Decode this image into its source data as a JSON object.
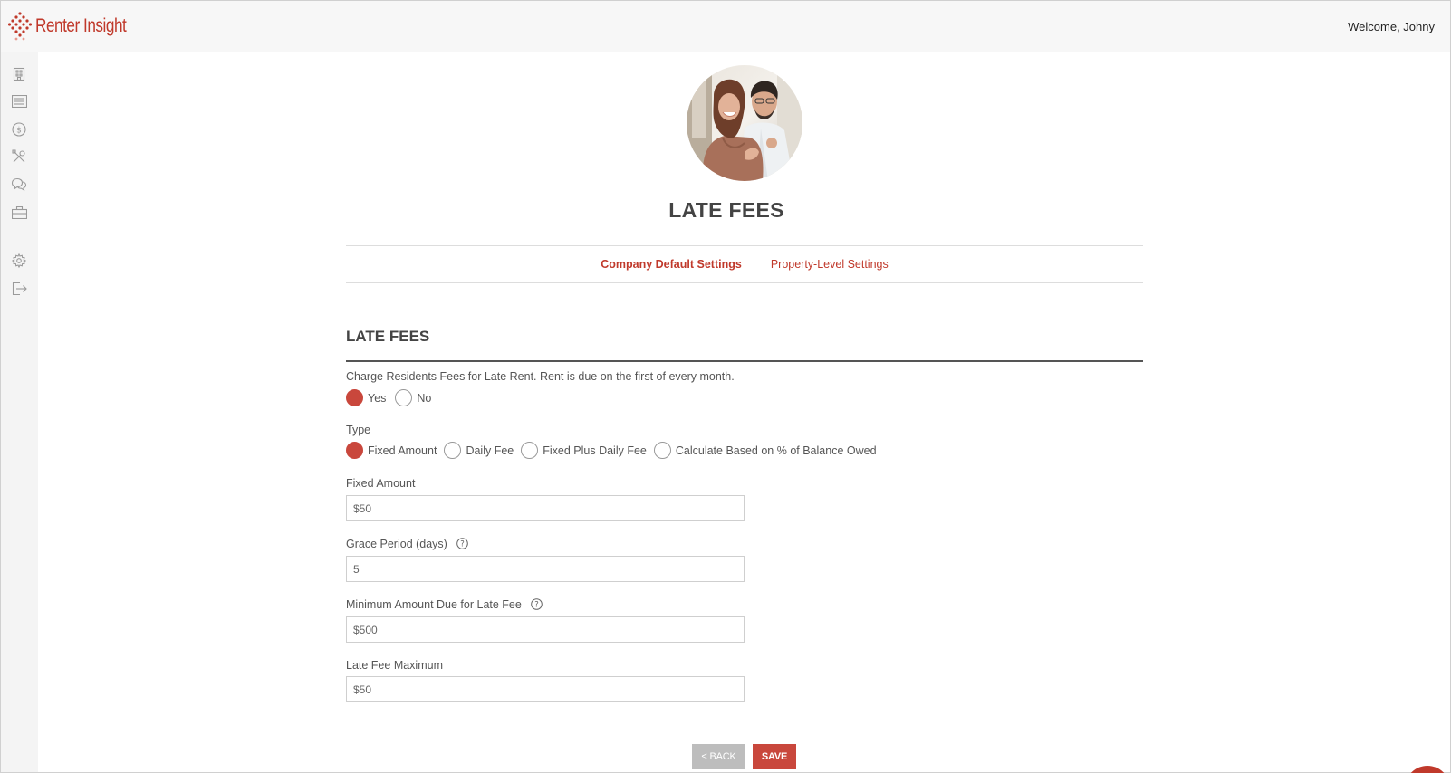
{
  "brand": {
    "name": "Renter Insight",
    "accent": "#c0392b"
  },
  "header": {
    "welcome": "Welcome, Johny"
  },
  "sidebar": {
    "items": [
      {
        "icon": "building-icon"
      },
      {
        "icon": "list-icon"
      },
      {
        "icon": "dollar-icon"
      },
      {
        "icon": "tools-icon"
      },
      {
        "icon": "chat-icon"
      },
      {
        "icon": "briefcase-icon"
      },
      {
        "icon": "gear-icon"
      },
      {
        "icon": "logout-icon"
      }
    ]
  },
  "page": {
    "title": "LATE FEES"
  },
  "tabs": [
    {
      "label": "Company Default Settings",
      "active": true
    },
    {
      "label": "Property-Level Settings",
      "active": false
    }
  ],
  "section": {
    "title": "LATE FEES",
    "charge_question": "Charge Residents Fees for Late Rent. Rent is due on the first of every month.",
    "charge_options": [
      {
        "label": "Yes",
        "checked": true
      },
      {
        "label": "No",
        "checked": false
      }
    ],
    "type_label": "Type",
    "type_options": [
      {
        "label": "Fixed Amount",
        "checked": true
      },
      {
        "label": "Daily Fee",
        "checked": false
      },
      {
        "label": "Fixed Plus Daily Fee",
        "checked": false
      },
      {
        "label": "Calculate Based on % of Balance Owed",
        "checked": false
      }
    ],
    "fixed_amount": {
      "label": "Fixed Amount",
      "value": "$50"
    },
    "grace_period": {
      "label": "Grace Period (days)",
      "value": "5"
    },
    "minimum_amount": {
      "label": "Minimum Amount Due for Late Fee",
      "value": "$500"
    },
    "late_fee_max": {
      "label": "Late Fee Maximum",
      "value": "$50"
    }
  },
  "buttons": {
    "back": "< BACK",
    "save": "SAVE"
  }
}
